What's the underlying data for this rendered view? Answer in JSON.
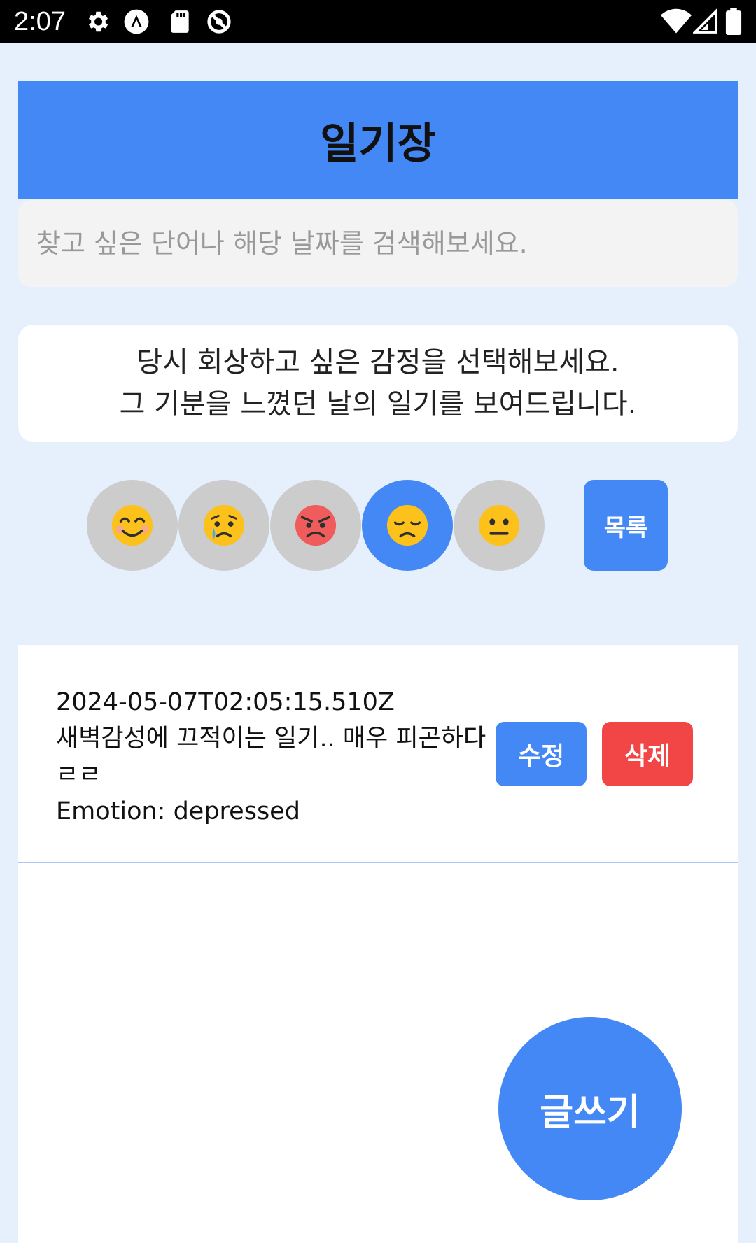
{
  "status_bar": {
    "time": "2:07",
    "icons_left": [
      "gear-icon",
      "android-auto-icon",
      "sd-card-icon",
      "blocked-icon"
    ],
    "icons_right": [
      "wifi-icon",
      "signal-icon",
      "battery-icon"
    ]
  },
  "header": {
    "title": "일기장"
  },
  "search": {
    "placeholder": "찾고 싶은 단어나 해당 날짜를 검색해보세요.",
    "value": ""
  },
  "prompt": {
    "line1": "당시 회상하고 싶은 감정을 선택해보세요.",
    "line2": "그 기분을 느꼈던 날의 일기를 보여드립니다."
  },
  "emotions": [
    {
      "icon": "smiling-face-icon",
      "selected": false
    },
    {
      "icon": "crying-face-icon",
      "selected": false
    },
    {
      "icon": "angry-face-icon",
      "selected": false
    },
    {
      "icon": "disappointed-face-icon",
      "selected": true
    },
    {
      "icon": "neutral-face-icon",
      "selected": false
    }
  ],
  "list_button": {
    "label": "목록"
  },
  "entries": [
    {
      "date": "2024-05-07T02:05:15.510Z",
      "content": "새벽감성에 끄적이는 일기.. 매우 피곤하다ㄹㄹ",
      "emotion": "Emotion: depressed",
      "edit_label": "수정",
      "delete_label": "삭제"
    }
  ],
  "write_button": {
    "label": "글쓰기"
  },
  "colors": {
    "background": "#e6f0fd",
    "accent": "#4488f5",
    "danger": "#f24545",
    "inactive": "#cccccc"
  }
}
